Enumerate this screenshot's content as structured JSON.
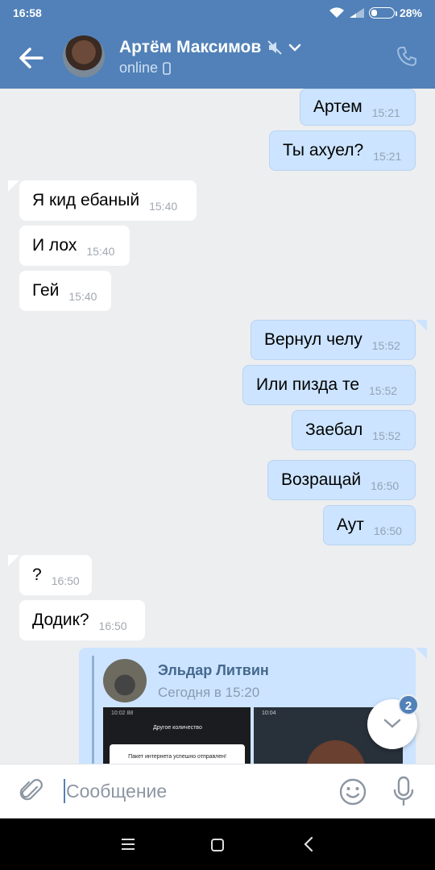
{
  "status_bar": {
    "time": "16:58",
    "battery": "28%",
    "battery_level": 0.28
  },
  "header": {
    "name": "Артём Максимов",
    "status": "online",
    "bg_color": "#5181b8"
  },
  "messages": [
    {
      "dir": "out",
      "text": "Артем",
      "time": "15:21"
    },
    {
      "dir": "out",
      "text": "Ты ахуел?",
      "time": "15:21"
    },
    {
      "dir": "in",
      "text": "Я кид ебаный",
      "time": "15:40"
    },
    {
      "dir": "in",
      "text": "И лох",
      "time": "15:40"
    },
    {
      "dir": "in",
      "text": "Гей",
      "time": "15:40"
    },
    {
      "dir": "out",
      "text": "Вернул челу",
      "time": "15:52"
    },
    {
      "dir": "out",
      "text": "Или пизда те",
      "time": "15:52"
    },
    {
      "dir": "out",
      "text": "Заебал",
      "time": "15:52"
    },
    {
      "dir": "out",
      "text": "Возращай",
      "time": "16:50"
    },
    {
      "dir": "out",
      "text": "Аут",
      "time": "16:50"
    },
    {
      "dir": "in",
      "text": "?",
      "time": "16:50"
    },
    {
      "dir": "in",
      "text": "Додик?",
      "time": "16:50"
    }
  ],
  "forwarded": {
    "author": "Эльдар Литвин",
    "date": "Сегодня в 15:20",
    "screenshot1": {
      "status_time": "10:02 88",
      "title": "Другое количество",
      "card_text": "Пакет интернета успешно отправлен!"
    },
    "screenshot2": {
      "status_time": "10:04"
    }
  },
  "scroll_button": {
    "unread_count": "2"
  },
  "composer": {
    "placeholder": "Сообщение"
  },
  "colors": {
    "outgoing_bubble": "#cce4ff",
    "incoming_bubble": "#ffffff",
    "chat_bg": "#edeef0",
    "accent": "#5181b8"
  }
}
